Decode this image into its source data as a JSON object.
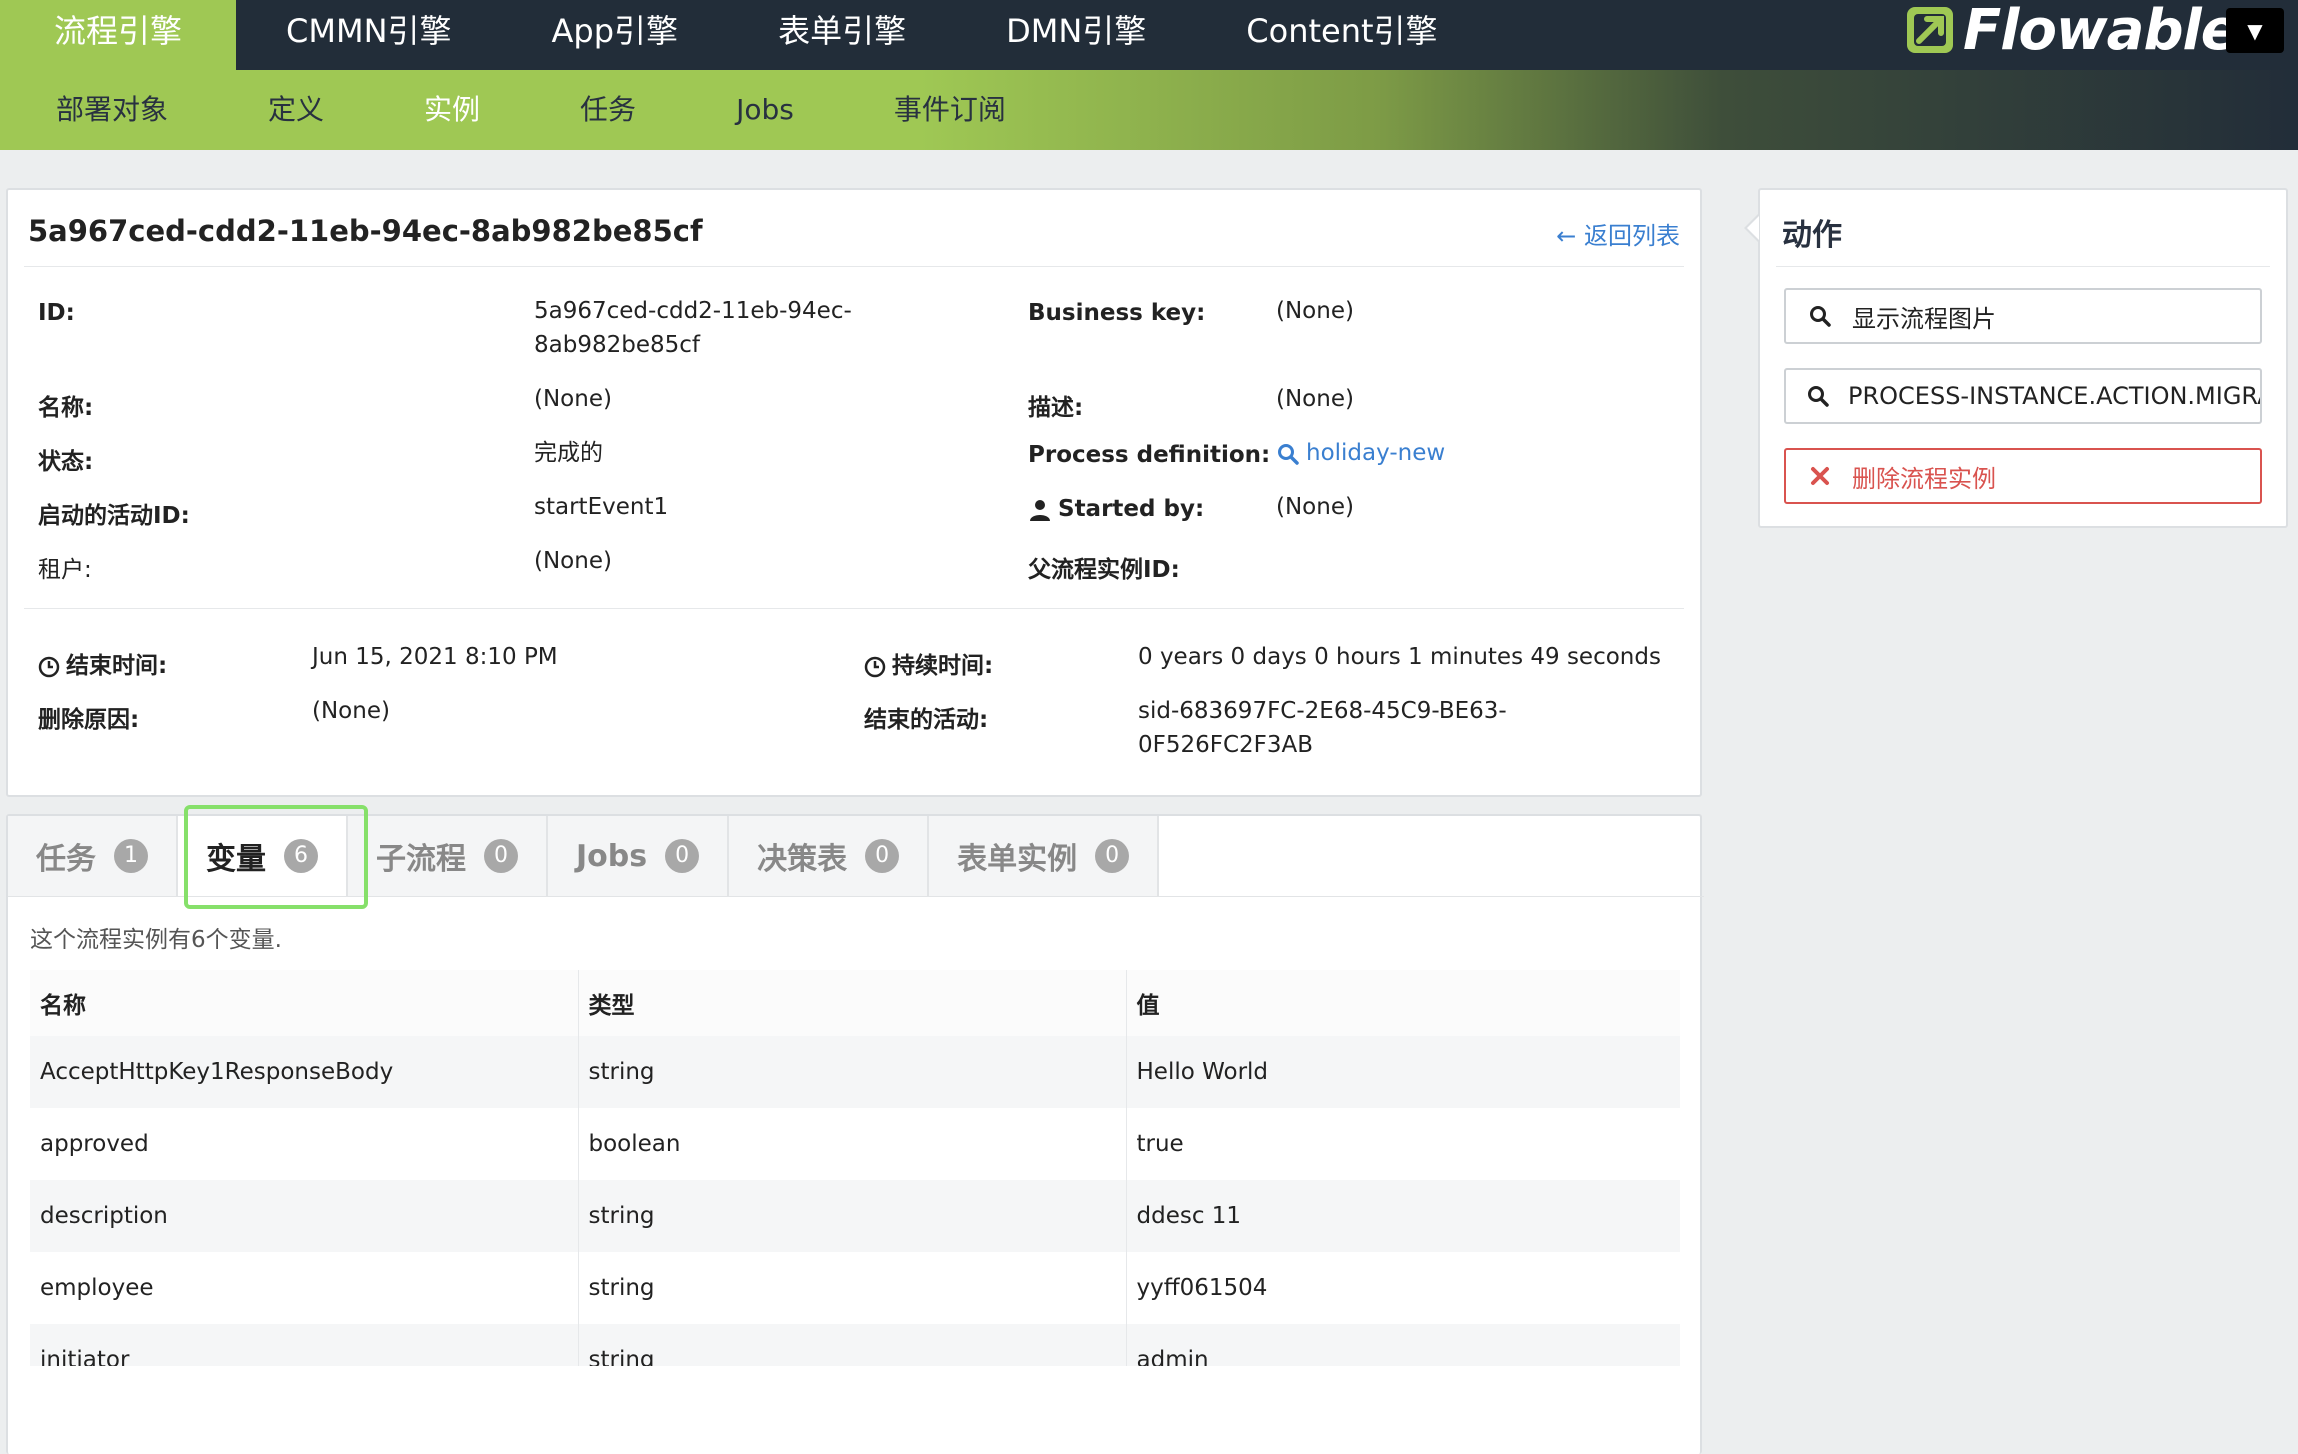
{
  "top_nav": [
    "流程引擎",
    "CMMN引擎",
    "App引擎",
    "表单引擎",
    "DMN引擎",
    "Content引擎"
  ],
  "sub_nav": [
    "部署对象",
    "定义",
    "实例",
    "任务",
    "Jobs",
    "事件订阅"
  ],
  "logo": "Flowable",
  "instance": {
    "title": "5a967ced-cdd2-11eb-94ec-8ab982be85cf",
    "back_label": "← 返回列表",
    "id_label": "ID:",
    "id_line1": "5a967ced-cdd2-11eb-94ec-",
    "id_line2": "8ab982be85cf",
    "business_key_label": "Business key:",
    "business_key": "(None)",
    "name_label": "名称:",
    "name": "(None)",
    "desc_label": "描述:",
    "desc": "(None)",
    "status_label": "状态:",
    "status": "完成的",
    "proc_def_label": "Process definition:",
    "proc_def": "holiday-new",
    "start_activity_label": "启动的活动ID:",
    "start_activity": "startEvent1",
    "started_by_label": "Started by:",
    "started_by": "(None)",
    "tenant_label": "租户:",
    "tenant": "(None)",
    "parent_label": "父流程实例ID:",
    "end_time_label": "结束时间:",
    "end_time": "Jun 15, 2021 8:10 PM",
    "duration_label": "持续时间:",
    "duration": "0 years 0 days 0 hours 1 minutes 49 seconds",
    "delete_reason_label": "删除原因:",
    "delete_reason": "(None)",
    "end_activity_label": "结束的活动:",
    "end_activity_line1": "sid-683697FC-2E68-45C9-BE63-",
    "end_activity_line2": "0F526FC2F3AB"
  },
  "actions": {
    "title": "动作",
    "show_diagram": "显示流程图片",
    "migrate": "PROCESS-INSTANCE.ACTION.MIGRATE",
    "delete": "删除流程实例"
  },
  "tabs": [
    {
      "label": "任务",
      "count": "1"
    },
    {
      "label": "变量",
      "count": "6"
    },
    {
      "label": "子流程",
      "count": "0"
    },
    {
      "label": "Jobs",
      "count": "0"
    },
    {
      "label": "决策表",
      "count": "0"
    },
    {
      "label": "表单实例",
      "count": "0"
    }
  ],
  "variables": {
    "summary": "这个流程实例有6个变量.",
    "headers": [
      "名称",
      "类型",
      "值"
    ],
    "rows": [
      [
        "AcceptHttpKey1ResponseBody",
        "string",
        "Hello World"
      ],
      [
        "approved",
        "boolean",
        "true"
      ],
      [
        "description",
        "string",
        "ddesc 11"
      ],
      [
        "employee",
        "string",
        "yyff061504"
      ],
      [
        "initiator",
        "string",
        "admin"
      ]
    ]
  },
  "colors": {
    "nav_dark": "#222d39",
    "brand_green": "#9fc854",
    "link_blue": "#3a7fd0",
    "danger_red": "#d9534f",
    "focus_green": "#86e06a"
  }
}
